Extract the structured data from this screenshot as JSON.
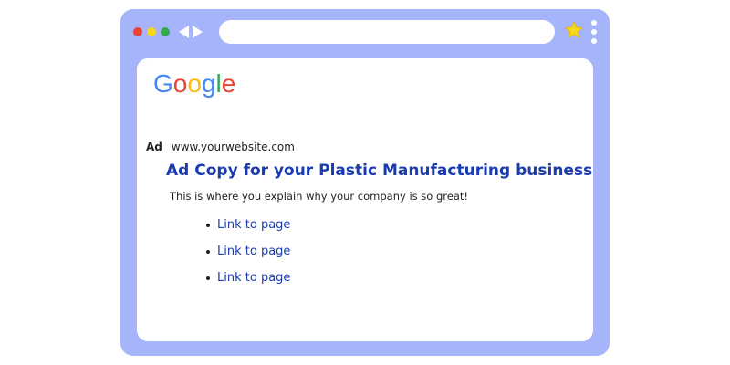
{
  "browser": {
    "frame_color": "#a5b4fb",
    "traffic_lights": [
      "#ea4335",
      "#f9d71c",
      "#34a853"
    ],
    "star_color": "#f9d71c",
    "icons": {
      "back": "arrow-left-icon",
      "forward": "arrow-right-icon",
      "bookmark": "star-icon",
      "menu": "kebab-menu-icon"
    }
  },
  "page": {
    "logo": {
      "letters": [
        "G",
        "o",
        "o",
        "g",
        "l",
        "e"
      ],
      "colors": [
        "#4285f4",
        "#ea4335",
        "#fbbc05",
        "#4285f4",
        "#34a853",
        "#ea4335"
      ]
    },
    "ad": {
      "tag": "Ad",
      "url": "www.yourwebsite.com",
      "title": "Ad Copy for your Plastic Manufacturing business",
      "description": "This is where you explain why your company is so great!",
      "links": [
        "Link to page",
        "Link to page",
        "Link to page"
      ]
    }
  }
}
